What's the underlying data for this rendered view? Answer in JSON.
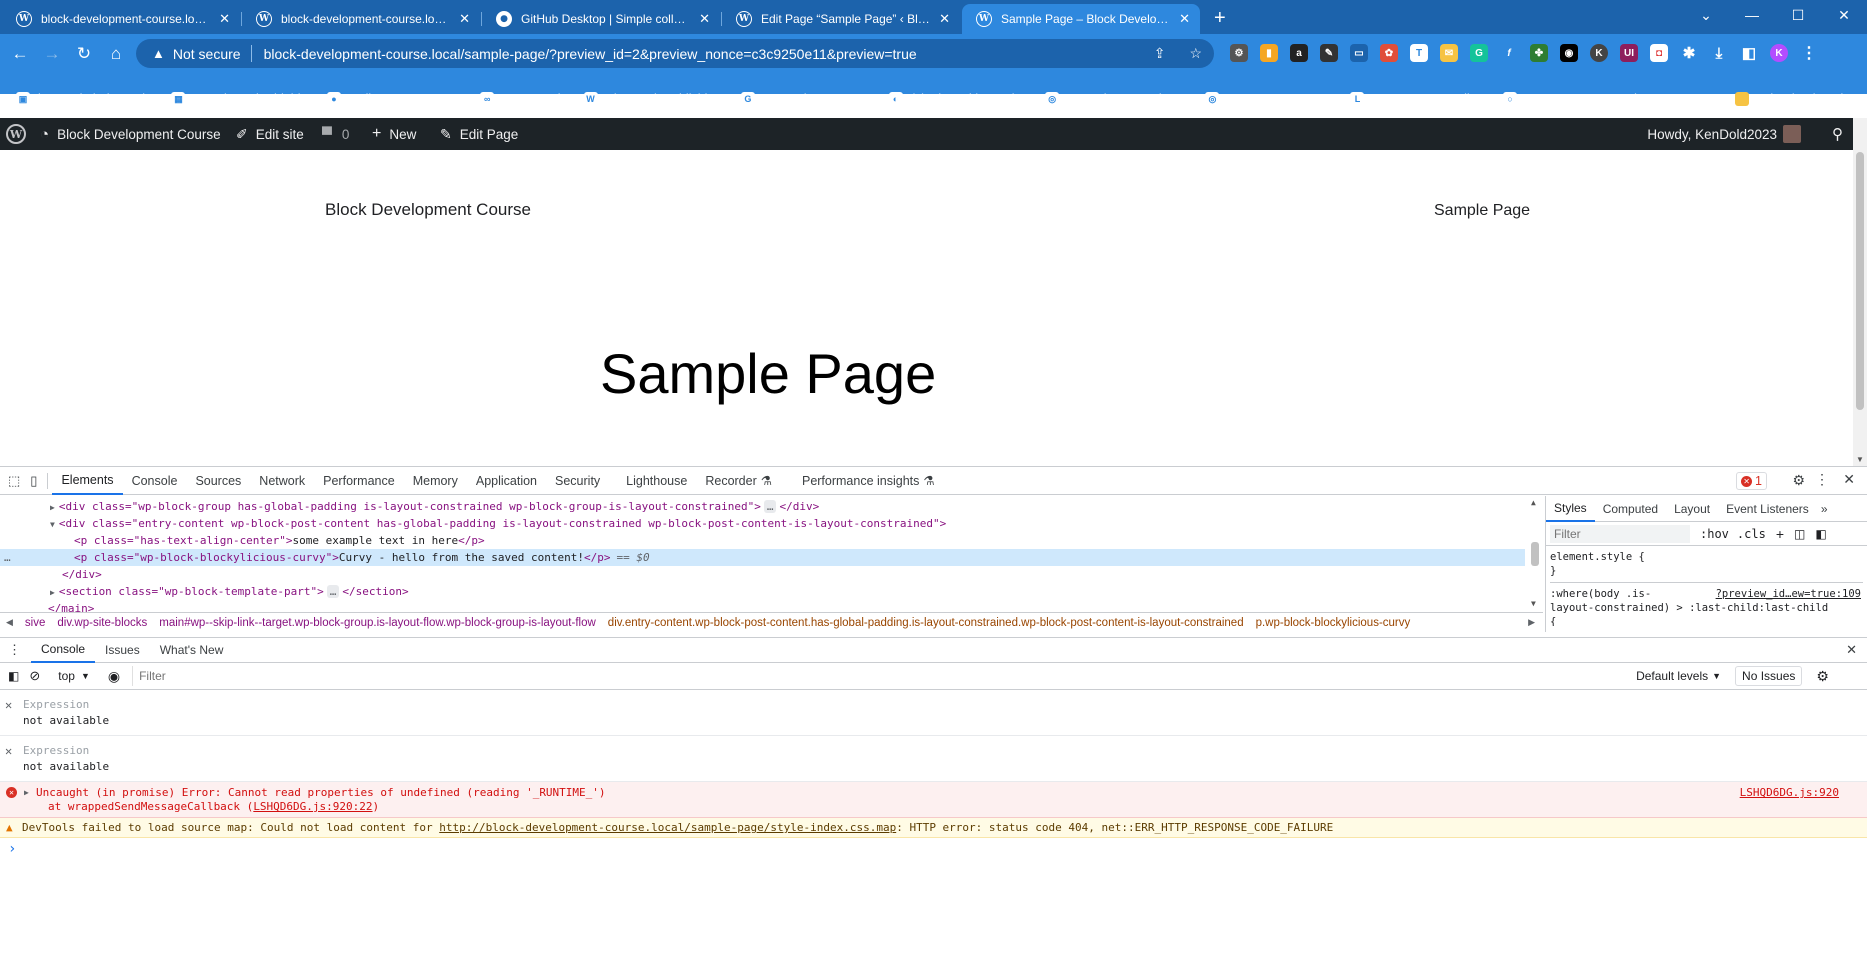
{
  "tabs": [
    {
      "title": "block-development-course.local/"
    },
    {
      "title": "block-development-course.local/"
    },
    {
      "title": "GitHub Desktop | Simple collabo"
    },
    {
      "title": "Edit Page “Sample Page” ‹ Block D"
    },
    {
      "title": "Sample Page – Block Developme"
    }
  ],
  "omnibox": {
    "security": "Not secure",
    "url": "block-development-course.local/sample-page/?preview_id=2&preview_nonce=c3c9250e11&preview=true"
  },
  "profile_initial": "K",
  "bookmarks": [
    {
      "label": "ken and Linda Desi..."
    },
    {
      "label": "Google Embeddabl..."
    },
    {
      "label": "Online Courses - A..."
    },
    {
      "label": "WHM Login"
    },
    {
      "label": "Blog Tool, Publishin..."
    },
    {
      "label": "Demo document -..."
    },
    {
      "label": "(7) Discord | #newb..."
    },
    {
      "label": "Free Thesaurus | Sy..."
    },
    {
      "label": "Home - Leverage..."
    },
    {
      "label": "Lorem Ipsum - All t..."
    },
    {
      "label": "Ocean Core Extensi..."
    }
  ],
  "other_bookmarks": "Other bookmarks",
  "wpbar": {
    "site": "Block Development Course",
    "edit_site": "Edit site",
    "comments": "0",
    "new": "New",
    "edit_page": "Edit Page",
    "howdy": "Howdy, KenDold2023"
  },
  "page": {
    "site_title": "Block Development Course",
    "nav_link": "Sample Page",
    "heading": "Sample Page"
  },
  "devtools": {
    "tabs": [
      "Elements",
      "Console",
      "Sources",
      "Network",
      "Performance",
      "Memory",
      "Application",
      "Security",
      "Lighthouse",
      "Recorder",
      "Performance insights"
    ],
    "error_count": "1",
    "dom": {
      "l1a": "<div class=\"wp-block-group has-global-padding is-layout-constrained wp-block-group-is-layout-constrained\">",
      "l1b": "</div>",
      "l2": "<div class=\"entry-content wp-block-post-content has-global-padding is-layout-constrained wp-block-post-content-is-layout-constrained\">",
      "l3a": "<p class=\"has-text-align-center\">",
      "l3b": "some example text in here",
      "l3c": "</p>",
      "l4a": "<p class=\"wp-block-blockylicious-curvy\">",
      "l4b": "Curvy - hello from the saved content!",
      "l4c": "</p>",
      "l4d": "== $0",
      "l5": "</div>",
      "l6a": "<section class=\"wp-block-template-part\">",
      "l6b": "</section>",
      "l7": "</main>"
    },
    "breadcrumbs": [
      "sive",
      "div.wp-site-blocks",
      "main#wp--skip-link--target.wp-block-group.is-layout-flow.wp-block-group-is-layout-flow",
      "div.entry-content.wp-block-post-content.has-global-padding.is-layout-constrained.wp-block-post-content-is-layout-constrained",
      "p.wp-block-blockylicious-curvy"
    ],
    "styles_tabs": [
      "Styles",
      "Computed",
      "Layout",
      "Event Listeners"
    ],
    "styles_filter": "Filter",
    "hov": ":hov",
    "cls": ".cls",
    "style_rule1": "element.style {",
    "style_rule1b": "}",
    "style_rule2a": ":where(body .is-",
    "style_rule2b": "layout-constrained) > :last-child:last-child",
    "style_rule2c": "{",
    "style_src": "?preview_id…ew=true:109",
    "drawer_tabs": [
      "Console",
      "Issues",
      "What's New"
    ],
    "context": "top",
    "filter_placeholder": "Filter",
    "levels": "Default levels",
    "no_issues": "No Issues",
    "expressions": [
      {
        "label": "Expression",
        "value": "not available"
      },
      {
        "label": "Expression",
        "value": "not available"
      }
    ],
    "error1": "Uncaught (in promise) Error: Cannot read properties of undefined (reading '_RUNTIME_')",
    "error1_source": "LSHQD6DG.js:920",
    "error1_stack_prefix": "at wrappedSendMessageCallback (",
    "error1_stack_link": "LSHQD6DG.js:920:22",
    "error1_stack_suffix": ")",
    "warning_prefix": "DevTools failed to load source map: Could not load content for ",
    "warning_link": "http://block-development-course.local/sample-page/style-index.css.map",
    "warning_suffix": ": HTTP error: status code 404, net::ERR_HTTP_RESPONSE_CODE_FAILURE",
    "prompt": "›"
  }
}
